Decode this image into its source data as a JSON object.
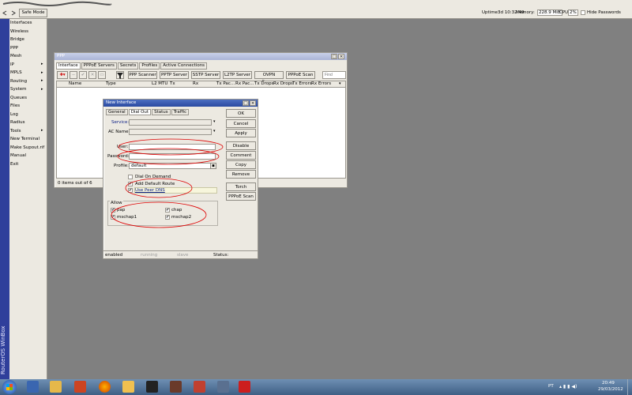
{
  "topbar": {
    "title_scribble": "",
    "safe_mode": "Safe Mode",
    "uptime_label": "Uptime:",
    "uptime": "3d 10:32:49",
    "memory_label": "Memory:",
    "memory": "228.9 MiB",
    "cpu_label": "CPU:",
    "cpu": "2%",
    "hide_passwords": "Hide Passwords"
  },
  "sidebar": {
    "items": [
      {
        "label": "Interfaces"
      },
      {
        "label": "Wireless"
      },
      {
        "label": "Bridge"
      },
      {
        "label": "PPP"
      },
      {
        "label": "Mesh"
      },
      {
        "label": "IP"
      },
      {
        "label": "MPLS"
      },
      {
        "label": "Routing"
      },
      {
        "label": "System"
      },
      {
        "label": "Queues"
      },
      {
        "label": "Files"
      },
      {
        "label": "Log"
      },
      {
        "label": "Radius"
      },
      {
        "label": "Tools"
      },
      {
        "label": "New Terminal"
      },
      {
        "label": "Make Supout.rif"
      },
      {
        "label": "Manual"
      },
      {
        "label": "Exit"
      }
    ],
    "vertical_brand": "RouterOS WinBox"
  },
  "ppp_window": {
    "title": "PPP",
    "tabs": [
      "Interface",
      "PPPoE Servers",
      "Secrets",
      "Profiles",
      "Active Connections"
    ],
    "toolbar_buttons": [
      "PPP Scanner",
      "PPTP Server",
      "SSTP Server",
      "L2TP Server",
      "OVPN Server",
      "PPPoE Scan"
    ],
    "find_placeholder": "Find",
    "columns": [
      "Name",
      "Type",
      "L2 MTU",
      "Tx",
      "Rx",
      "Tx Pac...",
      "Rx Pac...",
      "Tx Drops",
      "Rx Drops",
      "Tx Errors",
      "Rx Errors"
    ],
    "status": "0 items out of 6"
  },
  "dialog": {
    "title": "New Interface",
    "tabs": [
      "General",
      "Dial Out",
      "Status",
      "Traffic"
    ],
    "fields": {
      "service_label": "Service:",
      "ac_name_label": "AC Name:",
      "user_label": "User:",
      "password_label": "Password:",
      "profile_label": "Profile:",
      "profile_value": "default"
    },
    "checkboxes": {
      "dial_on_demand": "Dial On Demand",
      "add_default_route": "Add Default Route",
      "use_peer_dns": "Use Peer DNS"
    },
    "allow": {
      "title": "Allow",
      "pap": "pap",
      "chap": "chap",
      "mschap1": "mschap1",
      "mschap2": "mschap2"
    },
    "buttons": [
      "OK",
      "Cancel",
      "Apply",
      "Disable",
      "Comment",
      "Copy",
      "Remove",
      "Torch",
      "PPPoE Scan"
    ],
    "statusbar": [
      "enabled",
      "running",
      "slave",
      "Status:"
    ]
  },
  "taskbar": {
    "language": "PT",
    "time": "20:49",
    "date": "29/03/2012"
  }
}
